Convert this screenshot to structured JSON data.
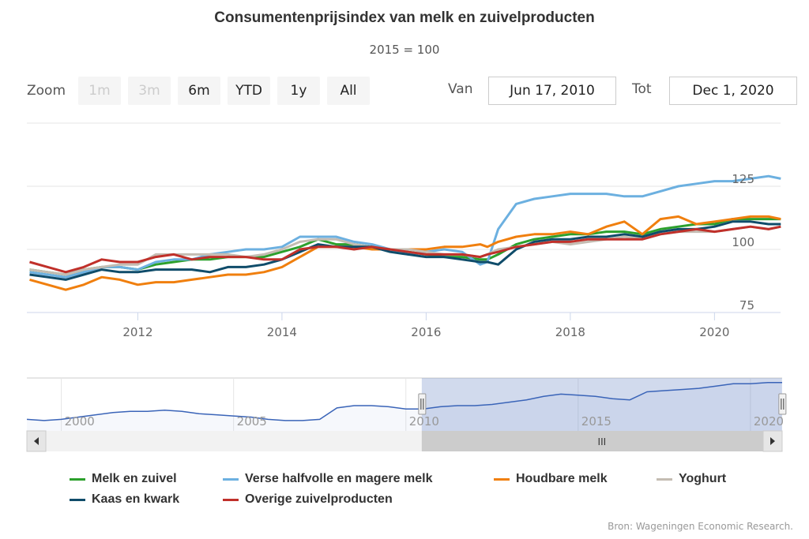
{
  "chart_data": {
    "type": "line",
    "title": "Consumentenprijsindex van melk en zuivelproducten",
    "subtitle": "2015 = 100",
    "xlabel": "",
    "ylabel": "",
    "x_range": [
      "2010-06-17",
      "2020-12-01"
    ],
    "ylim": [
      75,
      150
    ],
    "y_ticks": [
      75,
      100,
      125
    ],
    "x_ticks": [
      "2012",
      "2014",
      "2016",
      "2018",
      "2020"
    ],
    "grid": true,
    "legend_position": "bottom",
    "x": [
      2010.5,
      2010.75,
      2011.0,
      2011.25,
      2011.5,
      2011.75,
      2012.0,
      2012.25,
      2012.5,
      2012.75,
      2013.0,
      2013.25,
      2013.5,
      2013.75,
      2014.0,
      2014.25,
      2014.5,
      2014.75,
      2015.0,
      2015.25,
      2015.5,
      2015.75,
      2016.0,
      2016.25,
      2016.5,
      2016.75,
      2016.85,
      2017.0,
      2017.25,
      2017.5,
      2017.75,
      2018.0,
      2018.25,
      2018.5,
      2018.75,
      2019.0,
      2019.25,
      2019.5,
      2019.75,
      2020.0,
      2020.25,
      2020.5,
      2020.75,
      2020.92
    ],
    "series": [
      {
        "name": "Melk en zuivel",
        "color": "#2ca02c",
        "values": [
          92,
          91,
          90,
          92,
          93,
          93,
          92,
          94,
          95,
          96,
          96,
          97,
          97,
          97,
          99,
          101,
          104,
          102,
          102,
          101,
          100,
          99,
          98,
          97,
          97,
          96,
          96,
          98,
          102,
          104,
          105,
          106,
          106,
          107,
          107,
          106,
          108,
          109,
          110,
          110,
          112,
          112,
          112,
          112
        ]
      },
      {
        "name": "Verse halfvolle en magere melk",
        "color": "#6cb0e0",
        "values": [
          91,
          90,
          89,
          91,
          93,
          93,
          92,
          95,
          96,
          96,
          98,
          99,
          100,
          100,
          101,
          105,
          105,
          105,
          103,
          102,
          100,
          98,
          99,
          100,
          99,
          94,
          95,
          108,
          118,
          120,
          121,
          122,
          122,
          122,
          121,
          121,
          123,
          125,
          126,
          127,
          127,
          128,
          129,
          128
        ]
      },
      {
        "name": "Houdbare melk",
        "color": "#f07f0e",
        "values": [
          88,
          86,
          84,
          86,
          89,
          88,
          86,
          87,
          87,
          88,
          89,
          90,
          90,
          91,
          93,
          97,
          101,
          101,
          101,
          100,
          100,
          100,
          100,
          101,
          101,
          102,
          101,
          103,
          105,
          106,
          106,
          107,
          106,
          109,
          111,
          106,
          112,
          113,
          110,
          111,
          112,
          113,
          113,
          112
        ]
      },
      {
        "name": "Yoghurt",
        "color": "#c4bcb2",
        "values": [
          92,
          91,
          90,
          92,
          93,
          94,
          94,
          98,
          98,
          98,
          98,
          98,
          97,
          98,
          100,
          103,
          104,
          104,
          102,
          101,
          100,
          100,
          99,
          98,
          98,
          97,
          98,
          100,
          101,
          102,
          103,
          102,
          103,
          104,
          105,
          104,
          106,
          107,
          107,
          107,
          108,
          109,
          108,
          109
        ]
      },
      {
        "name": "Kaas en kwark",
        "color": "#0f4c6a",
        "values": [
          90,
          89,
          88,
          90,
          92,
          91,
          91,
          92,
          92,
          92,
          91,
          93,
          93,
          94,
          96,
          99,
          102,
          101,
          101,
          101,
          99,
          98,
          97,
          97,
          96,
          95,
          95,
          94,
          100,
          103,
          104,
          104,
          105,
          105,
          106,
          105,
          107,
          108,
          108,
          109,
          111,
          111,
          110,
          110
        ]
      },
      {
        "name": "Overige zuivelproducten",
        "color": "#c0302a",
        "values": [
          95,
          93,
          91,
          93,
          96,
          95,
          95,
          97,
          98,
          96,
          97,
          97,
          97,
          96,
          96,
          100,
          101,
          101,
          100,
          101,
          100,
          99,
          98,
          98,
          98,
          97,
          98,
          99,
          101,
          102,
          103,
          103,
          104,
          104,
          104,
          104,
          106,
          107,
          108,
          107,
          108,
          109,
          108,
          109
        ]
      }
    ],
    "navigator": {
      "x_ticks": [
        "2000",
        "2005",
        "2010",
        "2015",
        "2020"
      ],
      "series_x": [
        1999.0,
        1999.5,
        2000.0,
        2000.5,
        2001.0,
        2001.5,
        2002.0,
        2002.5,
        2003.0,
        2003.5,
        2004.0,
        2004.5,
        2005.0,
        2005.5,
        2006.0,
        2006.5,
        2007.0,
        2007.5,
        2008.0,
        2008.5,
        2009.0,
        2009.5,
        2010.0,
        2010.5,
        2011.0,
        2011.5,
        2012.0,
        2012.5,
        2013.0,
        2013.5,
        2014.0,
        2014.5,
        2015.0,
        2015.5,
        2016.0,
        2016.5,
        2017.0,
        2017.5,
        2018.0,
        2018.5,
        2019.0,
        2019.5,
        2020.0,
        2020.5,
        2020.92
      ],
      "series_values": [
        80,
        79,
        80,
        82,
        84,
        86,
        87,
        87,
        88,
        87,
        85,
        84,
        83,
        82,
        80,
        79,
        79,
        80,
        90,
        92,
        92,
        91,
        89,
        89,
        91,
        92,
        92,
        93,
        95,
        97,
        100,
        102,
        101,
        100,
        98,
        97,
        104,
        105,
        106,
        107,
        109,
        111,
        111,
        112,
        112
      ],
      "selected_range": [
        "2010-06-17",
        "2020-12-01"
      ]
    }
  },
  "header": {
    "title": "Consumentenprijsindex van melk en zuivelproducten",
    "subtitle": "2015 = 100"
  },
  "range_selector": {
    "zoom_label": "Zoom",
    "buttons": [
      {
        "label": "1m",
        "disabled": true
      },
      {
        "label": "3m",
        "disabled": true
      },
      {
        "label": "6m",
        "disabled": false
      },
      {
        "label": "YTD",
        "disabled": false
      },
      {
        "label": "1y",
        "disabled": false
      },
      {
        "label": "All",
        "disabled": false
      }
    ],
    "from_label": "Van",
    "from_value": "Jun 17, 2010",
    "to_label": "Tot",
    "to_value": "Dec 1, 2020"
  },
  "legend": [
    {
      "label": "Melk en zuivel",
      "color": "#2ca02c"
    },
    {
      "label": "Verse halfvolle en magere melk",
      "color": "#6cb0e0"
    },
    {
      "label": "Houdbare melk",
      "color": "#f07f0e"
    },
    {
      "label": "Yoghurt",
      "color": "#c4bcb2"
    },
    {
      "label": "Kaas en kwark",
      "color": "#0f4c6a"
    },
    {
      "label": "Overige zuivelproducten",
      "color": "#c0302a"
    }
  ],
  "credit": "Bron: Wageningen Economic Research.",
  "scrollbar": {
    "grip": "III",
    "left_arrow": "◀",
    "right_arrow": "▶"
  }
}
